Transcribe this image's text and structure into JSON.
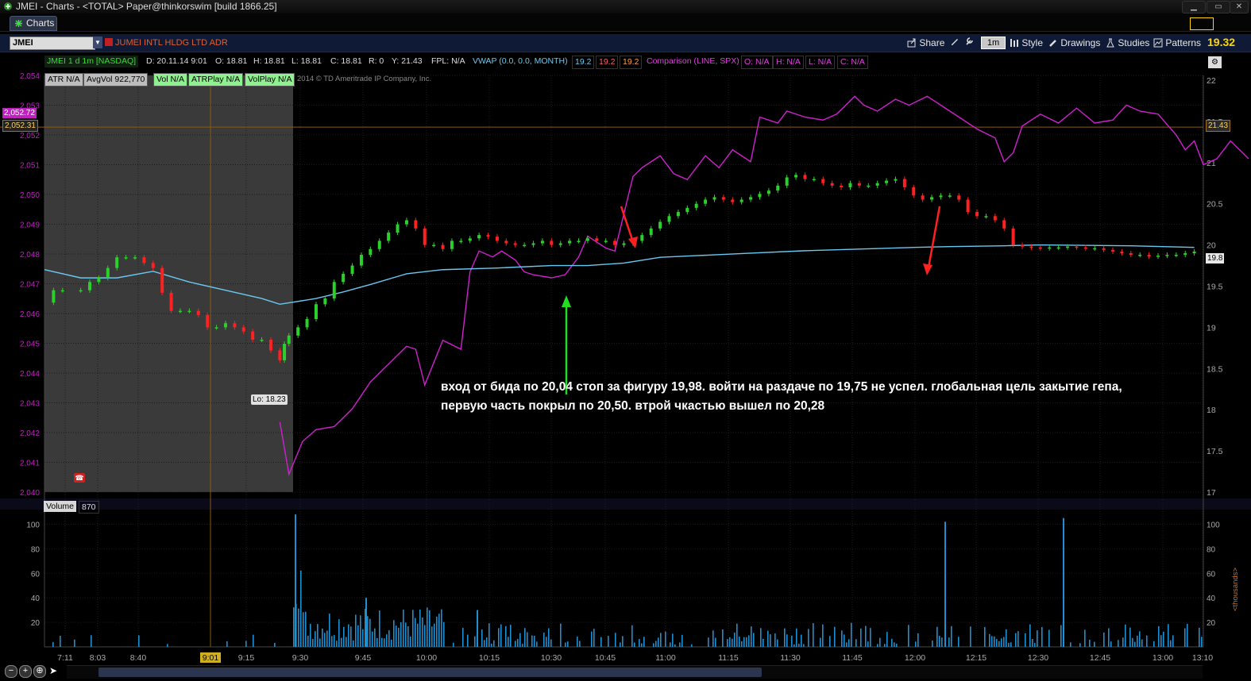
{
  "window": {
    "title": "JMEI - Charts - <TOTAL> Paper@thinkorswim [build 1866.25]",
    "tab_label": "Charts"
  },
  "toolbar": {
    "symbol": "JMEI",
    "company": "JUMEI INTL HLDG LTD ADR",
    "share": "Share",
    "timeframe": "1m",
    "style": "Style",
    "drawings": "Drawings",
    "studies": "Studies",
    "patterns": "Patterns",
    "last_price": "19.32"
  },
  "info_bar": {
    "descriptor": "JMEI 1 d 1m [NASDAQ]",
    "date": "D: 20.11.14 9:01",
    "open": "O: 18.81",
    "high": "H: 18.81",
    "low": "L: 18.81",
    "close": "C: 18.81",
    "range": "R: 0",
    "y": "Y: 21.43",
    "fpl": "FPL: N/A",
    "vwap": "VWAP (0.0, 0.0, MONTH)",
    "vwap_v1": "19.2",
    "vwap_v2": "19.2",
    "vwap_v3": "19.2",
    "comparison": "Comparison (LINE, SPX)",
    "comp_o": "O: N/A",
    "comp_h": "H: N/A",
    "comp_l": "L: N/A",
    "comp_c": "C: N/A"
  },
  "studies_row": {
    "atr": "ATR N/A",
    "avgvol": "AvgVol 922,770",
    "vol": "Vol N/A",
    "atrplay": "ATRPlay N/A",
    "volplay": "VolPlay N/A",
    "copyright": "2014 © TD Ameritrade IP Company, Inc."
  },
  "price_labels": {
    "comparison_level": "2,052.72",
    "comparison_level2": "2,052.31",
    "y_level": "21.43",
    "last": "19.8",
    "low_marker": "Lo: 18.23"
  },
  "annotation": {
    "line1": "вход от бида по 20,04 стоп за фигуру 19,98. войти на раздаче по 19,75 не успел. глобальная цель закытие гепа,",
    "line2": "первую часть покрыл по 20,50. втрой чкастью вышел по 20,28"
  },
  "volume_pane": {
    "label": "Volume",
    "value": "870",
    "unit_label": "<thousands>"
  },
  "colors": {
    "up": "#2bd12b",
    "down": "#ff2020",
    "vwap": "#6ac8f0",
    "comparison": "#d020d0",
    "volume": "#1e8fd0",
    "premarket": "#3a3a3a",
    "arrow_entry": "#22dd22",
    "arrow_exit": "#ff2020"
  },
  "chart_data": {
    "type": "candlestick",
    "symbol": "JMEI",
    "interval": "1m",
    "left_axis_ticks": [
      "2,054",
      "2,053",
      "2,052",
      "2,051",
      "2,050",
      "2,049",
      "2,048",
      "2,047",
      "2,046",
      "2,045",
      "2,044",
      "2,043",
      "2,042",
      "2,041",
      "2,040"
    ],
    "right_axis_ticks": [
      "22",
      "21.5",
      "21",
      "20.5",
      "20",
      "19.5",
      "19",
      "18.5",
      "18",
      "17.5",
      "17"
    ],
    "volume_ticks": [
      "100",
      "80",
      "60",
      "40",
      "20"
    ],
    "x_ticks": [
      "7:11",
      "8:03",
      "8:40",
      "9:01",
      "9:15",
      "9:30",
      "9:45",
      "10:00",
      "10:15",
      "10:30",
      "10:45",
      "11:00",
      "11:15",
      "11:30",
      "11:45",
      "12:00",
      "12:15",
      "12:30",
      "12:45",
      "13:00",
      "13:10"
    ],
    "price_range": [
      17,
      22
    ],
    "volume_range": [
      0,
      110
    ],
    "price_series": [
      [
        0,
        19.3
      ],
      [
        10,
        19.45
      ],
      [
        20,
        19.45
      ],
      [
        40,
        19.45
      ],
      [
        50,
        19.55
      ],
      [
        60,
        19.6
      ],
      [
        70,
        19.72
      ],
      [
        80,
        19.85
      ],
      [
        90,
        19.85
      ],
      [
        100,
        19.85
      ],
      [
        110,
        19.78
      ],
      [
        120,
        19.72
      ],
      [
        130,
        19.42
      ],
      [
        140,
        19.2
      ],
      [
        150,
        19.2
      ],
      [
        160,
        19.2
      ],
      [
        170,
        19.15
      ],
      [
        180,
        19.0
      ],
      [
        190,
        19.0
      ],
      [
        200,
        19.05
      ],
      [
        210,
        19.0
      ],
      [
        220,
        18.95
      ],
      [
        230,
        18.85
      ],
      [
        240,
        18.85
      ],
      [
        250,
        18.72
      ],
      [
        260,
        18.6
      ],
      [
        265,
        18.8
      ],
      [
        270,
        18.9
      ],
      [
        280,
        19.0
      ],
      [
        290,
        19.1
      ],
      [
        300,
        19.28
      ],
      [
        310,
        19.35
      ],
      [
        320,
        19.55
      ],
      [
        330,
        19.65
      ],
      [
        340,
        19.75
      ],
      [
        350,
        19.88
      ],
      [
        360,
        19.95
      ],
      [
        370,
        20.05
      ],
      [
        380,
        20.15
      ],
      [
        390,
        20.25
      ],
      [
        400,
        20.3
      ],
      [
        410,
        20.2
      ],
      [
        420,
        20.0
      ],
      [
        430,
        20.0
      ],
      [
        440,
        19.95
      ],
      [
        450,
        20.05
      ],
      [
        460,
        20.05
      ],
      [
        470,
        20.08
      ],
      [
        480,
        20.12
      ],
      [
        490,
        20.1
      ],
      [
        500,
        20.05
      ],
      [
        510,
        20.02
      ],
      [
        520,
        20.0
      ],
      [
        530,
        20.0
      ],
      [
        540,
        20.02
      ],
      [
        550,
        20.05
      ],
      [
        560,
        20.0
      ],
      [
        570,
        20.02
      ],
      [
        580,
        20.05
      ],
      [
        590,
        20.05
      ],
      [
        600,
        20.08
      ],
      [
        610,
        20.05
      ],
      [
        620,
        20.05
      ],
      [
        630,
        20.0
      ],
      [
        640,
        20.02
      ],
      [
        650,
        20.05
      ],
      [
        660,
        20.12
      ],
      [
        670,
        20.2
      ],
      [
        680,
        20.28
      ],
      [
        690,
        20.35
      ],
      [
        700,
        20.4
      ],
      [
        710,
        20.45
      ],
      [
        720,
        20.5
      ],
      [
        730,
        20.55
      ],
      [
        740,
        20.58
      ],
      [
        750,
        20.55
      ],
      [
        760,
        20.52
      ],
      [
        770,
        20.55
      ],
      [
        780,
        20.58
      ],
      [
        790,
        20.62
      ],
      [
        800,
        20.66
      ],
      [
        810,
        20.72
      ],
      [
        820,
        20.82
      ],
      [
        830,
        20.85
      ],
      [
        840,
        20.8
      ],
      [
        850,
        20.8
      ],
      [
        860,
        20.75
      ],
      [
        870,
        20.72
      ],
      [
        880,
        20.7
      ],
      [
        890,
        20.75
      ],
      [
        900,
        20.72
      ],
      [
        910,
        20.72
      ],
      [
        920,
        20.75
      ],
      [
        930,
        20.78
      ],
      [
        940,
        20.8
      ],
      [
        950,
        20.7
      ],
      [
        960,
        20.6
      ],
      [
        970,
        20.55
      ],
      [
        980,
        20.58
      ],
      [
        990,
        20.6
      ],
      [
        1000,
        20.6
      ],
      [
        1010,
        20.55
      ],
      [
        1020,
        20.4
      ],
      [
        1030,
        20.35
      ],
      [
        1040,
        20.35
      ],
      [
        1050,
        20.3
      ],
      [
        1060,
        20.2
      ],
      [
        1070,
        20.0
      ],
      [
        1080,
        19.98
      ],
      [
        1090,
        19.97
      ],
      [
        1100,
        19.96
      ],
      [
        1110,
        19.97
      ],
      [
        1120,
        19.97
      ],
      [
        1130,
        19.98
      ],
      [
        1140,
        19.97
      ],
      [
        1150,
        19.96
      ],
      [
        1160,
        19.96
      ],
      [
        1170,
        19.94
      ],
      [
        1180,
        19.92
      ],
      [
        1190,
        19.9
      ],
      [
        1200,
        19.88
      ],
      [
        1210,
        19.88
      ],
      [
        1220,
        19.86
      ],
      [
        1230,
        19.87
      ],
      [
        1240,
        19.88
      ],
      [
        1250,
        19.88
      ],
      [
        1260,
        19.9
      ],
      [
        1270,
        19.92
      ]
    ],
    "vwap_series": [
      [
        0,
        19.7
      ],
      [
        40,
        19.6
      ],
      [
        80,
        19.6
      ],
      [
        120,
        19.68
      ],
      [
        160,
        19.55
      ],
      [
        200,
        19.45
      ],
      [
        240,
        19.35
      ],
      [
        260,
        19.28
      ],
      [
        300,
        19.35
      ],
      [
        330,
        19.43
      ],
      [
        360,
        19.52
      ],
      [
        400,
        19.65
      ],
      [
        440,
        19.7
      ],
      [
        500,
        19.72
      ],
      [
        560,
        19.75
      ],
      [
        600,
        19.75
      ],
      [
        640,
        19.78
      ],
      [
        680,
        19.85
      ],
      [
        720,
        19.87
      ],
      [
        780,
        19.9
      ],
      [
        840,
        19.93
      ],
      [
        900,
        19.95
      ],
      [
        960,
        19.97
      ],
      [
        1000,
        19.98
      ],
      [
        1060,
        19.99
      ],
      [
        1100,
        20.0
      ],
      [
        1200,
        19.99
      ],
      [
        1270,
        19.97
      ]
    ],
    "comparison_series": [
      [
        260,
        2042.35
      ],
      [
        270,
        2040.6
      ],
      [
        285,
        2041.7
      ],
      [
        300,
        2042.1
      ],
      [
        320,
        2042.2
      ],
      [
        340,
        2042.8
      ],
      [
        360,
        2043.7
      ],
      [
        380,
        2044.3
      ],
      [
        400,
        2044.9
      ],
      [
        410,
        2044.8
      ],
      [
        420,
        2043.6
      ],
      [
        440,
        2045.1
      ],
      [
        460,
        2044.8
      ],
      [
        470,
        2047.4
      ],
      [
        480,
        2048.1
      ],
      [
        495,
        2047.9
      ],
      [
        505,
        2048.1
      ],
      [
        520,
        2047.8
      ],
      [
        530,
        2047.4
      ],
      [
        540,
        2047.3
      ],
      [
        560,
        2047.2
      ],
      [
        575,
        2047.3
      ],
      [
        590,
        2047.9
      ],
      [
        600,
        2048.6
      ],
      [
        620,
        2048.2
      ],
      [
        630,
        2048.1
      ],
      [
        650,
        2050.6
      ],
      [
        660,
        2050.9
      ],
      [
        680,
        2051.3
      ],
      [
        695,
        2050.7
      ],
      [
        710,
        2050.5
      ],
      [
        730,
        2051.3
      ],
      [
        745,
        2050.9
      ],
      [
        760,
        2051.5
      ],
      [
        780,
        2051.1
      ],
      [
        790,
        2052.6
      ],
      [
        810,
        2052.4
      ],
      [
        820,
        2052.8
      ],
      [
        840,
        2052.6
      ],
      [
        860,
        2052.5
      ],
      [
        875,
        2052.7
      ],
      [
        895,
        2053.3
      ],
      [
        905,
        2053.0
      ],
      [
        920,
        2052.8
      ],
      [
        940,
        2053.2
      ],
      [
        955,
        2053.0
      ],
      [
        975,
        2053.3
      ],
      [
        990,
        2053.0
      ],
      [
        1010,
        2052.6
      ],
      [
        1030,
        2052.2
      ],
      [
        1050,
        2051.9
      ],
      [
        1060,
        2051.1
      ],
      [
        1070,
        2051.4
      ],
      [
        1080,
        2052.3
      ],
      [
        1100,
        2052.7
      ],
      [
        1120,
        2052.4
      ],
      [
        1140,
        2052.9
      ],
      [
        1160,
        2052.4
      ],
      [
        1180,
        2052.5
      ],
      [
        1195,
        2053.0
      ],
      [
        1210,
        2052.8
      ],
      [
        1230,
        2052.7
      ],
      [
        1250,
        2052.0
      ],
      [
        1260,
        2051.5
      ],
      [
        1270,
        2051.8
      ],
      [
        1280,
        2051.0
      ],
      [
        1295,
        2051.2
      ],
      [
        1310,
        2051.8
      ],
      [
        1320,
        2051.5
      ],
      [
        1330,
        2051.2
      ]
    ]
  }
}
